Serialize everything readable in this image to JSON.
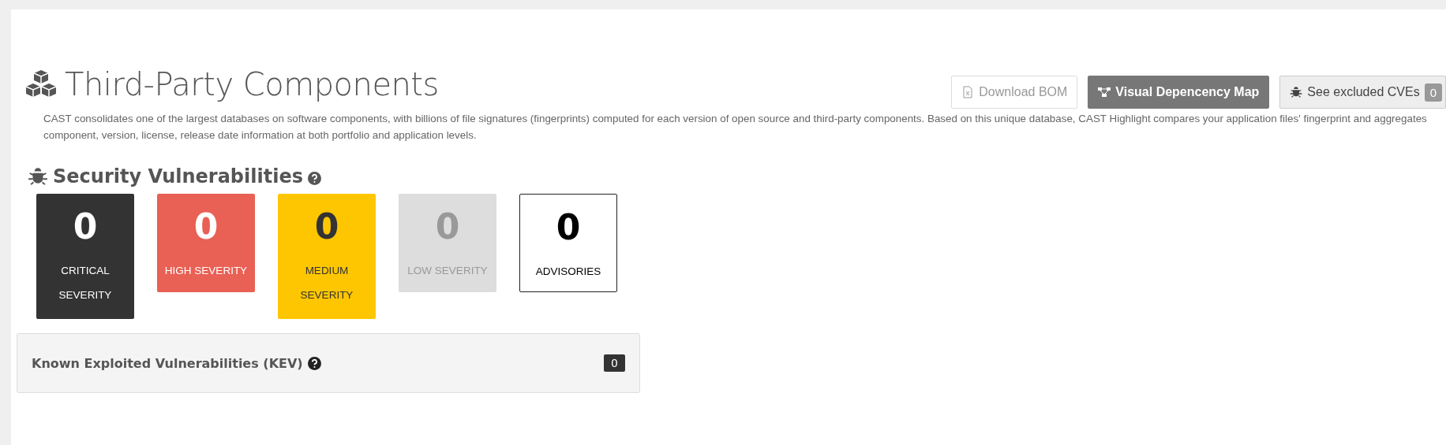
{
  "header": {
    "title": "Third-Party Components",
    "description": "CAST consolidates one of the largest databases on software components, with billions of file signatures (fingerprints) computed for each version of open source and third-party components. Based on this unique database, CAST Highlight compares your application files' fingerprint and aggregates component, version, license, release date information at both portfolio and application levels."
  },
  "actions": [
    {
      "kind": "download",
      "label": "Download BOM"
    },
    {
      "kind": "map",
      "label": "Visual Depencency Map"
    },
    {
      "kind": "excluded",
      "label": "See excluded CVEs",
      "count": "0"
    }
  ],
  "security": {
    "title": "Security Vulnerabilities",
    "tiles": [
      {
        "kind": "critical",
        "count": "0",
        "label": "CRITICAL SEVERITY"
      },
      {
        "kind": "high",
        "count": "0",
        "label": "HIGH SEVERITY"
      },
      {
        "kind": "medium",
        "count": "0",
        "label": "MEDIUM SEVERITY"
      },
      {
        "kind": "low",
        "count": "0",
        "label": "LOW SEVERITY"
      },
      {
        "kind": "advisory",
        "count": "0",
        "label": "ADVISORIES"
      }
    ]
  },
  "kev": {
    "title": "Known Exploited Vulnerabilities (KEV)",
    "count": "0"
  }
}
